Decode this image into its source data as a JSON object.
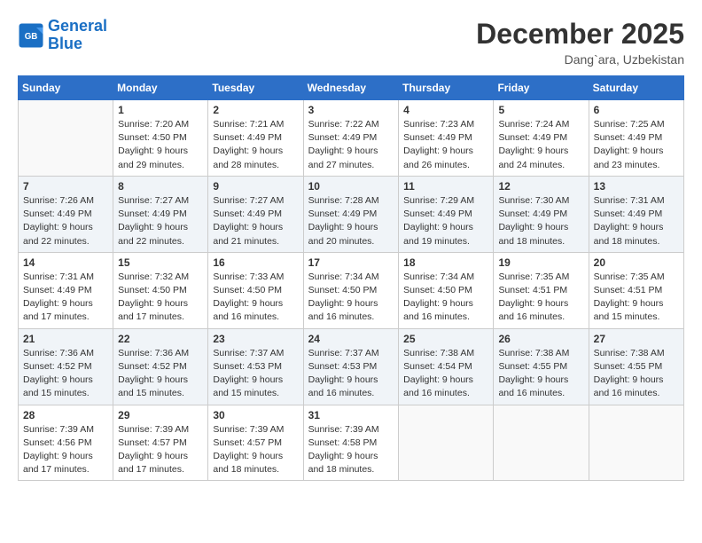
{
  "logo": {
    "line1": "General",
    "line2": "Blue"
  },
  "title": "December 2025",
  "location": "Dang`ara, Uzbekistan",
  "weekdays": [
    "Sunday",
    "Monday",
    "Tuesday",
    "Wednesday",
    "Thursday",
    "Friday",
    "Saturday"
  ],
  "weeks": [
    [
      {
        "day": "",
        "info": ""
      },
      {
        "day": "1",
        "info": "Sunrise: 7:20 AM\nSunset: 4:50 PM\nDaylight: 9 hours\nand 29 minutes."
      },
      {
        "day": "2",
        "info": "Sunrise: 7:21 AM\nSunset: 4:49 PM\nDaylight: 9 hours\nand 28 minutes."
      },
      {
        "day": "3",
        "info": "Sunrise: 7:22 AM\nSunset: 4:49 PM\nDaylight: 9 hours\nand 27 minutes."
      },
      {
        "day": "4",
        "info": "Sunrise: 7:23 AM\nSunset: 4:49 PM\nDaylight: 9 hours\nand 26 minutes."
      },
      {
        "day": "5",
        "info": "Sunrise: 7:24 AM\nSunset: 4:49 PM\nDaylight: 9 hours\nand 24 minutes."
      },
      {
        "day": "6",
        "info": "Sunrise: 7:25 AM\nSunset: 4:49 PM\nDaylight: 9 hours\nand 23 minutes."
      }
    ],
    [
      {
        "day": "7",
        "info": "Sunrise: 7:26 AM\nSunset: 4:49 PM\nDaylight: 9 hours\nand 22 minutes."
      },
      {
        "day": "8",
        "info": "Sunrise: 7:27 AM\nSunset: 4:49 PM\nDaylight: 9 hours\nand 22 minutes."
      },
      {
        "day": "9",
        "info": "Sunrise: 7:27 AM\nSunset: 4:49 PM\nDaylight: 9 hours\nand 21 minutes."
      },
      {
        "day": "10",
        "info": "Sunrise: 7:28 AM\nSunset: 4:49 PM\nDaylight: 9 hours\nand 20 minutes."
      },
      {
        "day": "11",
        "info": "Sunrise: 7:29 AM\nSunset: 4:49 PM\nDaylight: 9 hours\nand 19 minutes."
      },
      {
        "day": "12",
        "info": "Sunrise: 7:30 AM\nSunset: 4:49 PM\nDaylight: 9 hours\nand 18 minutes."
      },
      {
        "day": "13",
        "info": "Sunrise: 7:31 AM\nSunset: 4:49 PM\nDaylight: 9 hours\nand 18 minutes."
      }
    ],
    [
      {
        "day": "14",
        "info": "Sunrise: 7:31 AM\nSunset: 4:49 PM\nDaylight: 9 hours\nand 17 minutes."
      },
      {
        "day": "15",
        "info": "Sunrise: 7:32 AM\nSunset: 4:50 PM\nDaylight: 9 hours\nand 17 minutes."
      },
      {
        "day": "16",
        "info": "Sunrise: 7:33 AM\nSunset: 4:50 PM\nDaylight: 9 hours\nand 16 minutes."
      },
      {
        "day": "17",
        "info": "Sunrise: 7:34 AM\nSunset: 4:50 PM\nDaylight: 9 hours\nand 16 minutes."
      },
      {
        "day": "18",
        "info": "Sunrise: 7:34 AM\nSunset: 4:50 PM\nDaylight: 9 hours\nand 16 minutes."
      },
      {
        "day": "19",
        "info": "Sunrise: 7:35 AM\nSunset: 4:51 PM\nDaylight: 9 hours\nand 16 minutes."
      },
      {
        "day": "20",
        "info": "Sunrise: 7:35 AM\nSunset: 4:51 PM\nDaylight: 9 hours\nand 15 minutes."
      }
    ],
    [
      {
        "day": "21",
        "info": "Sunrise: 7:36 AM\nSunset: 4:52 PM\nDaylight: 9 hours\nand 15 minutes."
      },
      {
        "day": "22",
        "info": "Sunrise: 7:36 AM\nSunset: 4:52 PM\nDaylight: 9 hours\nand 15 minutes."
      },
      {
        "day": "23",
        "info": "Sunrise: 7:37 AM\nSunset: 4:53 PM\nDaylight: 9 hours\nand 15 minutes."
      },
      {
        "day": "24",
        "info": "Sunrise: 7:37 AM\nSunset: 4:53 PM\nDaylight: 9 hours\nand 16 minutes."
      },
      {
        "day": "25",
        "info": "Sunrise: 7:38 AM\nSunset: 4:54 PM\nDaylight: 9 hours\nand 16 minutes."
      },
      {
        "day": "26",
        "info": "Sunrise: 7:38 AM\nSunset: 4:55 PM\nDaylight: 9 hours\nand 16 minutes."
      },
      {
        "day": "27",
        "info": "Sunrise: 7:38 AM\nSunset: 4:55 PM\nDaylight: 9 hours\nand 16 minutes."
      }
    ],
    [
      {
        "day": "28",
        "info": "Sunrise: 7:39 AM\nSunset: 4:56 PM\nDaylight: 9 hours\nand 17 minutes."
      },
      {
        "day": "29",
        "info": "Sunrise: 7:39 AM\nSunset: 4:57 PM\nDaylight: 9 hours\nand 17 minutes."
      },
      {
        "day": "30",
        "info": "Sunrise: 7:39 AM\nSunset: 4:57 PM\nDaylight: 9 hours\nand 18 minutes."
      },
      {
        "day": "31",
        "info": "Sunrise: 7:39 AM\nSunset: 4:58 PM\nDaylight: 9 hours\nand 18 minutes."
      },
      {
        "day": "",
        "info": ""
      },
      {
        "day": "",
        "info": ""
      },
      {
        "day": "",
        "info": ""
      }
    ]
  ]
}
